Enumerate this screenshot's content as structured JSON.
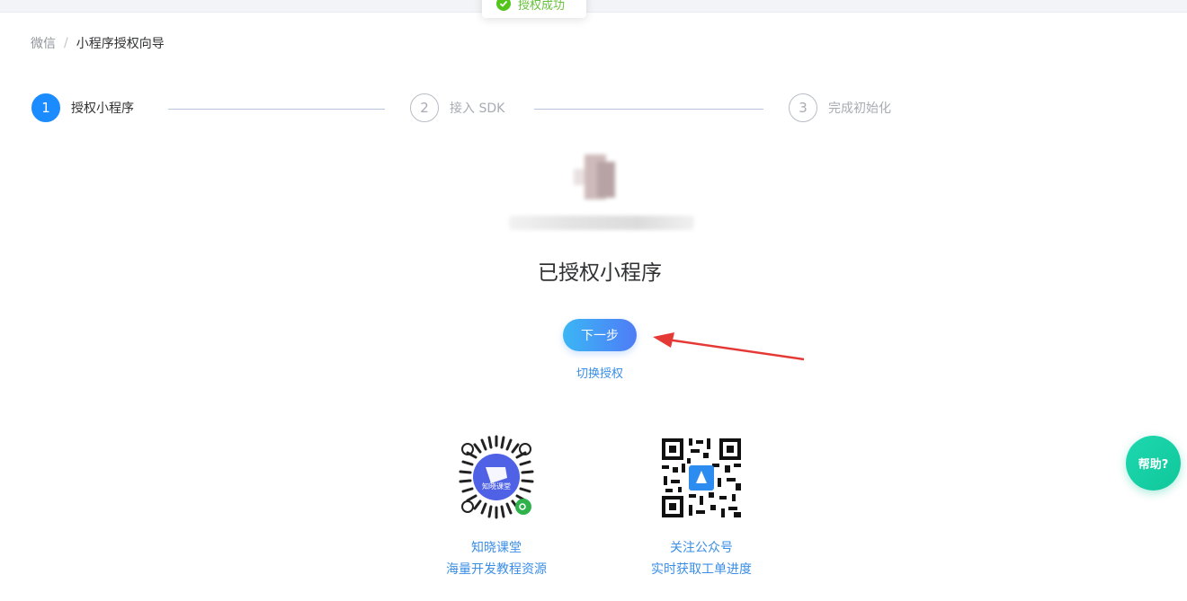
{
  "toast": {
    "message": "授权成功",
    "icon": "check-circle-icon",
    "color": "#52c41a"
  },
  "breadcrumb": {
    "items": [
      "微信",
      "小程序授权向导"
    ],
    "separator": "/"
  },
  "steps": [
    {
      "number": "1",
      "label": "授权小程序",
      "state": "active"
    },
    {
      "number": "2",
      "label": "接入 SDK",
      "state": "pending"
    },
    {
      "number": "3",
      "label": "完成初始化",
      "state": "pending"
    }
  ],
  "main": {
    "status_title": "已授权小程序",
    "next_button": "下一步",
    "switch_link": "切换授权"
  },
  "qr_codes": [
    {
      "icon": "miniprogram-code-icon",
      "line1": "知晓课堂",
      "line2": "海量开发教程资源",
      "badge_text": "知晓课堂"
    },
    {
      "icon": "wechat-qrcode-icon",
      "line1": "关注公众号",
      "line2": "实时获取工单进度"
    }
  ],
  "help": {
    "label": "帮助?"
  },
  "colors": {
    "primary": "#1a8cff",
    "link": "#3a8ee6",
    "help": "#10c79a",
    "annotation_arrow": "#e53935"
  }
}
